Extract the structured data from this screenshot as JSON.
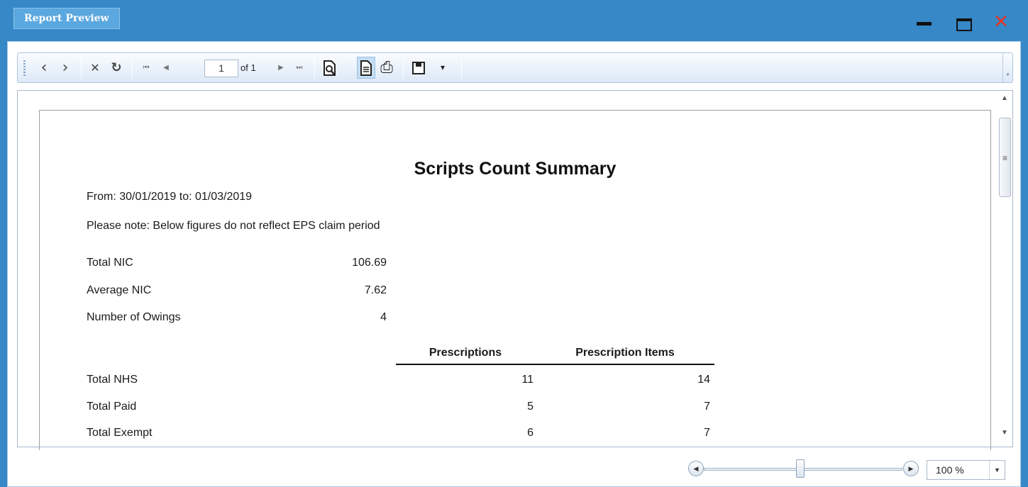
{
  "window": {
    "title": "Report Preview",
    "close_glyph": "✕"
  },
  "toolbar": {
    "back_glyph": "‹",
    "forward_glyph": "›",
    "stop_glyph": "✕",
    "refresh_glyph": "↻",
    "first_glyph": "⏮",
    "prev_glyph": "◀",
    "current_page": "1",
    "page_of": "of 1",
    "next_glyph": "▶",
    "last_glyph": "⏭",
    "print_glyph": "⎙",
    "export_dropdown_glyph": "▾"
  },
  "report": {
    "title": "Scripts Count Summary",
    "date_range": "From: 30/01/2019 to: 01/03/2019",
    "note": "Please note: Below figures do not reflect EPS claim period",
    "summary": [
      {
        "label": "Total NIC",
        "value": "106.69"
      },
      {
        "label": "Average NIC",
        "value": "7.62"
      },
      {
        "label": "Number of Owings",
        "value": "4"
      }
    ],
    "table": {
      "headers": [
        "Prescriptions",
        "Prescription Items"
      ],
      "rows": [
        {
          "label": "Total NHS",
          "prescriptions": "11",
          "items": "14"
        },
        {
          "label": "Total Paid",
          "prescriptions": "5",
          "items": "7"
        },
        {
          "label": "Total Exempt",
          "prescriptions": "6",
          "items": "7"
        }
      ]
    }
  },
  "zoom": {
    "value": "100 %",
    "level_fraction": 0.5
  },
  "colors": {
    "titlebar": "#3788c7",
    "title_tab": "#5ba7df",
    "close": "#e53522"
  },
  "icons": [
    "back-icon",
    "forward-icon",
    "stop-icon",
    "refresh-icon",
    "first-page-icon",
    "previous-page-icon",
    "next-page-icon",
    "last-page-icon",
    "find-icon",
    "page-layout-icon",
    "print-icon",
    "save-icon"
  ]
}
